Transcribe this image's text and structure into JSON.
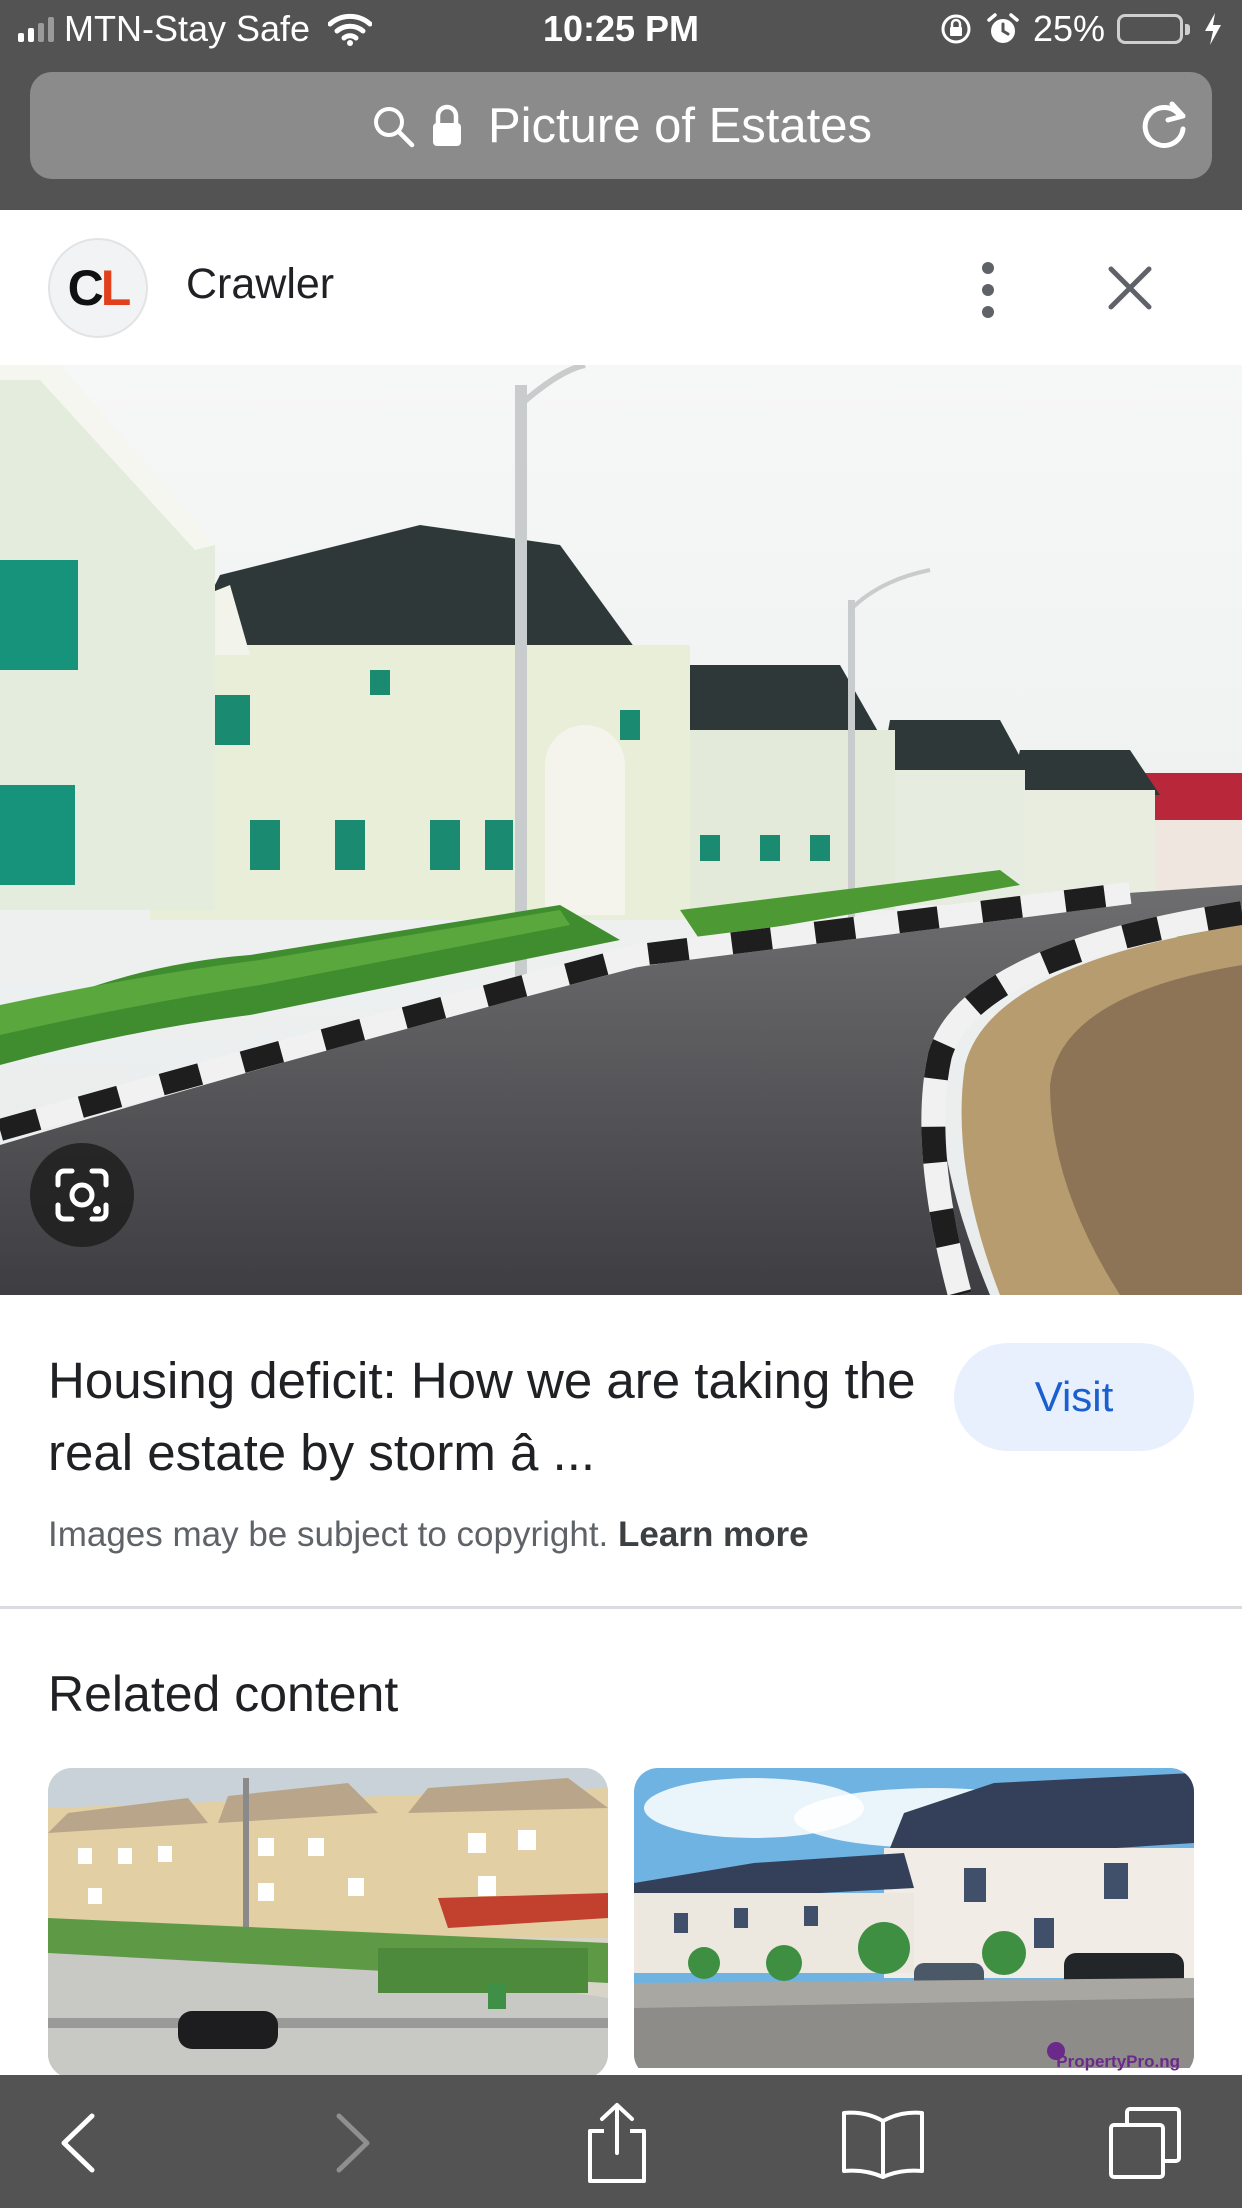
{
  "status_bar": {
    "carrier": "MTN-Stay Safe",
    "time": "10:25 PM",
    "battery": "25%",
    "battery_level": 0.25
  },
  "url_bar": {
    "title": "Picture of Estates"
  },
  "source": {
    "avatar_letters": [
      "C",
      "L"
    ],
    "name": "Crawler"
  },
  "result": {
    "headline": "Housing deficit: How we are taking the real estate by storm â ...",
    "visit_label": "Visit",
    "copyright_text": "Images may be subject to copyright.",
    "learn_more_label": "Learn more"
  },
  "related": {
    "title": "Related content",
    "items": [
      {
        "watermark": ""
      },
      {
        "watermark": "PropertyPro.ng"
      }
    ]
  },
  "icons": {
    "search": "search-icon",
    "lock": "lock-icon",
    "reload": "reload-icon",
    "more": "more-vert-icon",
    "close": "close-icon",
    "lens": "lens-icon",
    "back": "chevron-left-icon",
    "forward": "chevron-right-icon",
    "share": "share-icon",
    "bookmarks": "book-icon",
    "tabs": "tabs-icon"
  },
  "colors": {
    "chrome": "#535353",
    "url_bar": "#8b8b8b",
    "visit_bg": "#e8f0fe",
    "visit_text": "#1a5fd0",
    "logo_red": "#e2401d",
    "battery_green": "#4cd964"
  }
}
